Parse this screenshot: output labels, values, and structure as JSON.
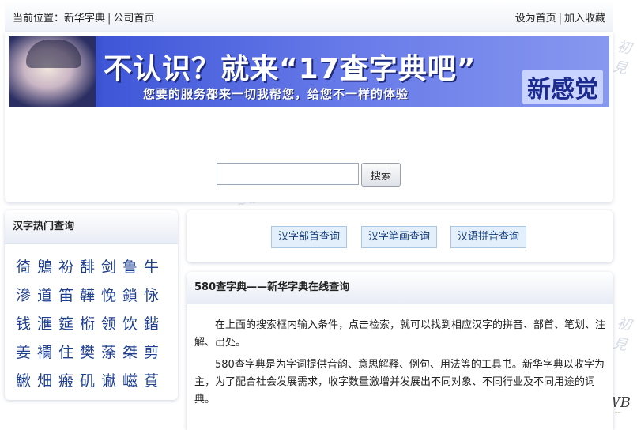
{
  "header": {
    "breadcrumb_prefix": "当前位置：",
    "breadcrumb_links": [
      "新华字典",
      "公司首页"
    ],
    "separator": "|",
    "right_links": [
      "设为首页",
      "加入收藏"
    ]
  },
  "banner": {
    "headline": "不认识？就来“17查字典吧”",
    "subline": "您要的服务都来一切我帮您，给您不一样的体验",
    "badge": "新感觉"
  },
  "search": {
    "input_value": "",
    "button_label": "搜索"
  },
  "hot_chars": {
    "title": "汉字热门查询",
    "chars": [
      "徛",
      "鶂",
      "衯",
      "馡",
      "剑",
      "鲁",
      "牛",
      "滲",
      "道",
      "笛",
      "韡",
      "悗",
      "鎖",
      "怺",
      "钱",
      "滙",
      "筵",
      "椼",
      "领",
      "饮",
      "鍇",
      "姜",
      "襴",
      "住",
      "樊",
      "蒤",
      "桀",
      "剪",
      "鰍",
      "畑",
      "瘢",
      "矶",
      "谳",
      "嵫",
      "萯"
    ]
  },
  "tabs": [
    "汉字部首查询",
    "汉字笔画查询",
    "汉语拼音查询"
  ],
  "info": {
    "title": "580查字典——新华字典在线查询",
    "paragraphs": [
      "在上面的搜索框内输入条件，点击检索，就可以找到相应汉字的拼音、部首、笔划、注解、出处。",
      "580查字典是为字词提供音韵、意思解释、例句、用法等的工具书。新华字典以收字为主，为了配合社会发展需求，收字数量激增并发展出不同对象、不同行业及不同用途的词典。"
    ]
  },
  "colors": {
    "link_blue": "#1f3f8f",
    "tab_bg": "#e3f0fb",
    "tab_border": "#a8c6e6",
    "banner_blue": "#3f57d8"
  }
}
